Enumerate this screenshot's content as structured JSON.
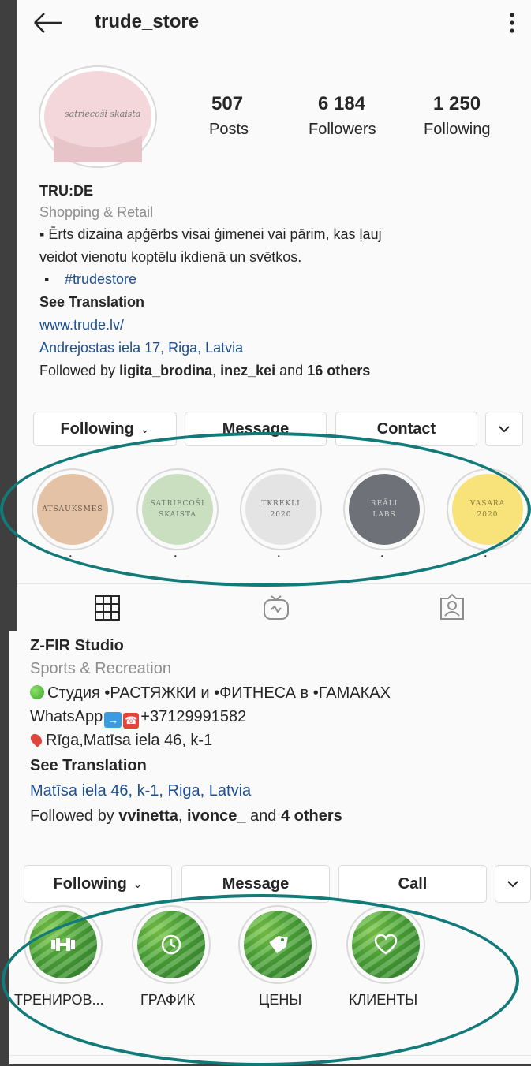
{
  "profile1": {
    "username": "trude_store",
    "stats": [
      {
        "value": "507",
        "label": "Posts"
      },
      {
        "value": "6 184",
        "label": "Followers"
      },
      {
        "value": "1 250",
        "label": "Following"
      }
    ],
    "avatar_text": "satriecoši skaista",
    "name": "TRU:DE",
    "category": "Shopping & Retail",
    "bio_line1": "▪ Ērts dizaina apģērbs visai ģimenei vai pārim, kas ļauj",
    "bio_line2": "veidot vienotu koptēlu ikdienā un svētkos.",
    "hashtag_bullet": "▪",
    "hashtag": "#trudestore",
    "see_translation": "See Translation",
    "website": "www.trude.lv/",
    "address": "Andrejostas iela 17, Riga, Latvia",
    "followed_prefix": "Followed by ",
    "followed_user1": "ligita_brodina",
    "followed_sep": ", ",
    "followed_user2": "inez_kei",
    "followed_and": " and ",
    "followed_others": "16 others",
    "buttons": {
      "following": "Following",
      "message": "Message",
      "contact": "Contact"
    },
    "highlights": [
      {
        "line1": "ATSAUKSMES",
        "line2": "",
        "color": "#e3c2a6"
      },
      {
        "line1": "SATRIECOŠI",
        "line2": "SKAISTA",
        "color": "#c9dfc0"
      },
      {
        "line1": "TKREKLI",
        "line2": "2020",
        "color": "#e4e4e4"
      },
      {
        "line1": "REĀLI",
        "line2": "LABS",
        "color": "#6e7177"
      },
      {
        "line1": "VASARA",
        "line2": "2020",
        "color": "#f8e27a"
      }
    ],
    "highlight_dot": "·",
    "tabs": [
      "grid-icon",
      "igtv-icon",
      "tagged-icon"
    ]
  },
  "profile2": {
    "name": "Z-FIR Studio",
    "category": "Sports & Recreation",
    "bio_line1": "Студия •РАСТЯЖКИ и •ФИТНЕСА в •ГАМАКАХ",
    "bio_line2_prefix": "WhatsApp",
    "bio_line2_phone": "+37129991582",
    "bio_line3": "Rīga,Matīsa iela 46, k-1",
    "see_translation": "See Translation",
    "address": "Matīsa iela 46, k-1, Riga, Latvia",
    "followed_prefix": "Followed by ",
    "followed_user1": "vvinetta",
    "followed_sep": ", ",
    "followed_user2": "ivonce_",
    "followed_and": " and ",
    "followed_others": "4 others",
    "buttons": {
      "following": "Following",
      "message": "Message",
      "call": "Call"
    },
    "highlights": [
      {
        "label": "ТРЕНИРОВ...",
        "icon": "dumbbell-icon"
      },
      {
        "label": "ГРАФИК",
        "icon": "clock-icon"
      },
      {
        "label": "ЦЕНЫ",
        "icon": "tag-icon"
      },
      {
        "label": "КЛИЕНТЫ",
        "icon": "heart-icon"
      }
    ]
  },
  "colors": {
    "link": "#1d4f91",
    "annotation_oval": "#127a78",
    "background": "#fafafa"
  }
}
